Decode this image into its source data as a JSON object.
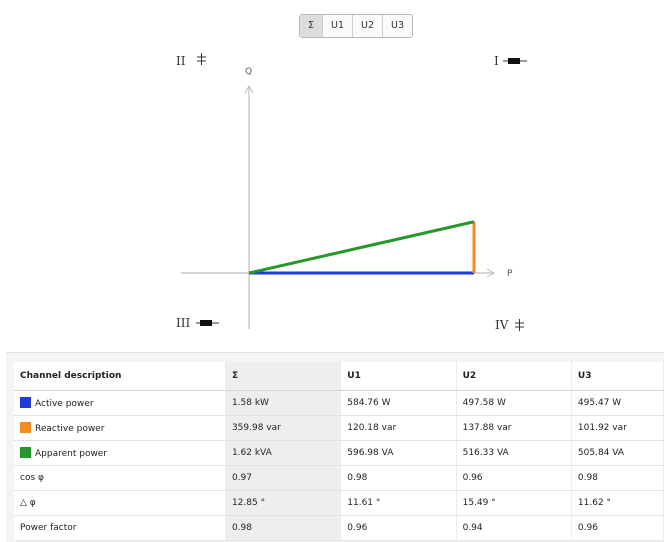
{
  "tabs": [
    {
      "label": "Σ",
      "active": true
    },
    {
      "label": "U1",
      "active": false
    },
    {
      "label": "U2",
      "active": false
    },
    {
      "label": "U3",
      "active": false
    }
  ],
  "diagram": {
    "q_axis_label": "Q",
    "p_axis_label": "P",
    "quadrants": {
      "I": "I",
      "II": "II",
      "III": "III",
      "IV": "IV"
    },
    "vector": {
      "active_power_kW": 1.58,
      "reactive_power_var": 359.98,
      "apparent_power_kVA": 1.62
    }
  },
  "colors": {
    "active": "#1f3bd4",
    "reactive": "#f28c1e",
    "apparent": "#27962b"
  },
  "table": {
    "headers": [
      "Channel description",
      "Σ",
      "U1",
      "U2",
      "U3"
    ],
    "rows": [
      {
        "label": "Active power",
        "swatch": "active",
        "values": [
          "1.58 kW",
          "584.76 W",
          "497.58 W",
          "495.47 W"
        ]
      },
      {
        "label": "Reactive power",
        "swatch": "reactive",
        "values": [
          "359.98 var",
          "120.18 var",
          "137.88 var",
          "101.92 var"
        ]
      },
      {
        "label": "Apparent power",
        "swatch": "apparent",
        "values": [
          "1.62 kVA",
          "596.98 VA",
          "516.33 VA",
          "505.84 VA"
        ]
      },
      {
        "label": "cos φ",
        "swatch": null,
        "values": [
          "0.97",
          "0.98",
          "0.96",
          "0.98"
        ]
      },
      {
        "label": "△ φ",
        "swatch": null,
        "values": [
          "12.85 °",
          "11.61 °",
          "15.49 °",
          "11.62 °"
        ]
      },
      {
        "label": "Power factor",
        "swatch": null,
        "values": [
          "0.98",
          "0.96",
          "0.94",
          "0.96"
        ]
      }
    ]
  }
}
